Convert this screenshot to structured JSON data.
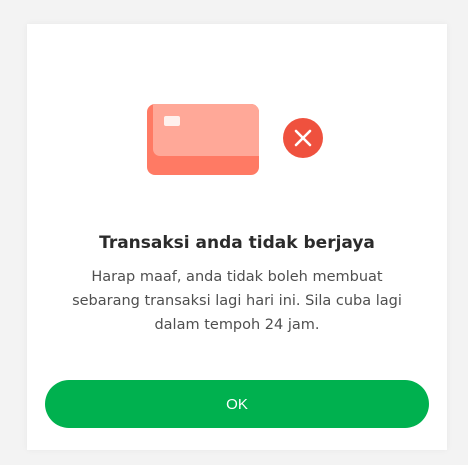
{
  "dialog": {
    "illustration": {
      "card_icon": "credit-card-icon",
      "status_icon": "close-icon",
      "status_color": "#ef513e",
      "card_color": "#ff7a64"
    },
    "title": "Transaksi anda tidak berjaya",
    "message": "Harap maaf, anda tidak boleh membuat\nsebarang transaksi lagi hari ini. Sila cuba lagi\ndalam tempoh 24 jam.",
    "ok_label": "OK",
    "button_color": "#00b14f"
  }
}
